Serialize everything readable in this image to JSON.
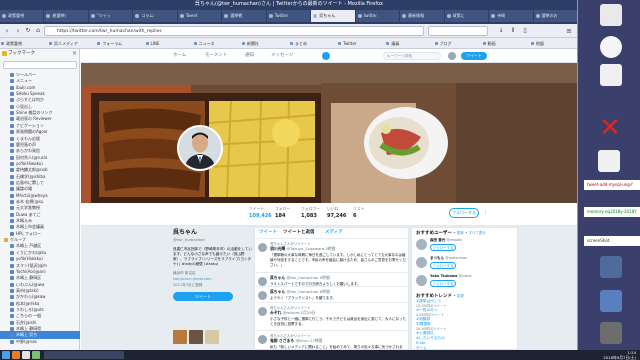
{
  "window": {
    "title": "呉ちゃん(@twr_humachan)さん | Twitterからの最新のツイート - Mozilla Firefox",
    "tabs": [
      "政策重視",
      "総選挙(",
      "\"ツイッ",
      "コラム:",
      "Tweet",
      "選挙戦",
      "Twitter",
      "呉ちゃん",
      "twitter.",
      "最新情報",
      "政策に",
      "寺崎",
      "選挙のお"
    ],
    "url": "https://twitter.com/twr_humachan/with_replies"
  },
  "bookmarks_bar": [
    "政策重視",
    "呉人メディア",
    "フォーラム",
    "LINE",
    "ニュース",
    "新聞社",
    "まとめ",
    "Twitter",
    "議員",
    "ブログ",
    "動画",
    "地図"
  ],
  "sidebar": {
    "header": "ブックマーク",
    "items": [
      {
        "label": "ツールバー"
      },
      {
        "label": "メニュー"
      },
      {
        "label": "ibuki.com"
      },
      {
        "label": "SHoku Speeak"
      },
      {
        "label": "ぷらすとは何か"
      },
      {
        "label": "小見出し"
      },
      {
        "label": "Shine 雑話のリンク"
      },
      {
        "label": "政治家の Reviewer"
      },
      {
        "label": "ナビゲーション"
      },
      {
        "label": "原発問題のAgoor"
      },
      {
        "label": "くまもん応援"
      },
      {
        "label": "鹿児島の声"
      },
      {
        "label": "あらかわ発信"
      },
      {
        "label": "田村秀人(@rural"
      },
      {
        "label": "yoYo(Hiwaku)"
      },
      {
        "label": "倉持麟太郎@nob"
      },
      {
        "label": "石橋学(@ishiba"
      },
      {
        "label": "広島市に関して"
      },
      {
        "label": "議論の場"
      },
      {
        "label": "Mhichi(@wheya"
      },
      {
        "label": "赤木 宏規(@su"
      },
      {
        "label": "元大学准教授"
      },
      {
        "label": "Duwa あてご"
      },
      {
        "label": "木嶋えみ"
      },
      {
        "label": "木嶋上市会議員"
      },
      {
        "label": "HPL フォロー"
      },
      {
        "label": "グループ"
      },
      {
        "label": "木嶋上 戸越区"
      },
      {
        "label": "くりにかわ(@ku"
      },
      {
        "label": "yoYo(Hiwaku)"
      },
      {
        "label": "スマン(稲沢(@m"
      },
      {
        "label": "Yochi(Aoi)@ani"
      },
      {
        "label": "木嶋上 静岡区"
      },
      {
        "label": "いわぶん(@iwa"
      },
      {
        "label": "高市(@taki)"
      },
      {
        "label": "かかわら(@kaw"
      },
      {
        "label": "松本(@rikka"
      },
      {
        "label": "うわしろ(@uts"
      },
      {
        "label": "こちらの 一般"
      },
      {
        "label": "石井(@ishi"
      },
      {
        "label": "木嶋上 静岡県"
      },
      {
        "label": "木嶋上 呉ち"
      },
      {
        "label": "中野(@nak"
      }
    ],
    "selected_index": 41
  },
  "twitter_nav": [
    "ホーム",
    "モーメント",
    "通知",
    "メッセージ"
  ],
  "twitter_search_placeholder": "キーワード検索",
  "twitter_tweet_button": "ツイート",
  "profile": {
    "name": "呉ちゃん",
    "handle": "@twr_humachan",
    "bio": "呉建仁市民団体で（野崎県寺市）の活動をしています。どんな小さな声でも届けたい（呉山野家）。ラブライブ!シリーズをラブライブ(ヨシタケ) | #ladyの絶壁 (#kaku)",
    "location": "横浜市 新吉区",
    "link": "twinjo-kun.jimdo.com",
    "joined": "2011年7月に登録",
    "tweet_button": "ツイート",
    "follow_button": "フォローする"
  },
  "stats": [
    {
      "label": "ツイート",
      "value": "109,426",
      "on": true
    },
    {
      "label": "フォロー",
      "value": "184",
      "on": false
    },
    {
      "label": "フォロワー",
      "value": "1,083",
      "on": false
    },
    {
      "label": "いいね",
      "value": "97,246",
      "on": false
    },
    {
      "label": "リスト",
      "value": "6",
      "on": false
    }
  ],
  "timeline": {
    "tabs": [
      "ツイート",
      "ツイートと返信",
      "メディア"
    ],
    "tweets": [
      {
        "retweet": "呉ちゃんさんがリツイート",
        "name": "須川光輝",
        "handle": "@Takuya_Sugawara 3時間",
        "text": "「選挙戦の大事な時期に毎日を過ごしています。しかし私にとってとても大事なのは議論や対話をすることです。市民の声を議会に届けるため、皆さんのご意見をお寄せください。」"
      },
      {
        "retweet": "",
        "name": "呉ちゃん",
        "handle": "@twr_humachan 5時間",
        "text": "ラストスパートですので引き続きよろしくお願いします。"
      },
      {
        "retweet": "",
        "name": "呉ちゃん",
        "handle": "@twr_humachan 8時間",
        "text": "ようやく「ブラックリスト」を観てます。"
      },
      {
        "retweet": "呉ちゃんさんがリツイート",
        "name": "みぞれ",
        "handle": "@mizore 1月29日",
        "text": "小さな子供と一緒に選挙に行こう。それで子どもは政治を身近に感じて、大人になったとき自然に投票する。"
      },
      {
        "retweet": "呉ちゃんさんがリツイート",
        "name": "鬼柳 さざまろ",
        "handle": "@kiryu 17時間",
        "text": "私も「新しいメディアに関わること」を始めてみて、周りの色々な事に気づかされます。"
      }
    ]
  },
  "recommendations": {
    "title": "おすすめユーザー",
    "refresh": "更新",
    "all": "すべて表示",
    "users": [
      {
        "name": "森田 貴光",
        "handle": "@mwaiki",
        "button": "フォローする"
      },
      {
        "name": "まつもん",
        "handle": "@matsumon",
        "button": "フォローする"
      },
      {
        "name": "Yaku Tsukawa",
        "handle": "@yakut",
        "button": "フォローする"
      }
    ]
  },
  "trends": {
    "title": "おすすめトレンド",
    "change": "変更",
    "items": [
      {
        "tag": "#選挙は行こう",
        "sub": "13,125件のツイート"
      },
      {
        "tag": "#一枚のみつ",
        "sub": "4,520件のツイート"
      },
      {
        "tag": "#相模原",
        "sub": ""
      },
      {
        "tag": "中間選挙",
        "sub": "20,105件のツイート"
      },
      {
        "tag": "#小選挙区",
        "sub": ""
      },
      {
        "tag": "#いろいろなもの",
        "sub": ""
      },
      {
        "tag": "Endo",
        "sub": ""
      },
      {
        "tag": "チーム",
        "sub": "28,640件のツイート"
      }
    ]
  },
  "desktop": {
    "tooltip1": "tweet-add-mysql-ung-f",
    "tooltip2": "memory-eq2018y-2018Y",
    "tooltip3": "screenShot"
  },
  "clock": {
    "time": "1:24",
    "date": "2018年9月7日(土)"
  },
  "colors": {
    "twitter_blue": "#1da1f2",
    "titlebar": "#2c3e66",
    "sidebar_selected": "#3d86d6"
  }
}
